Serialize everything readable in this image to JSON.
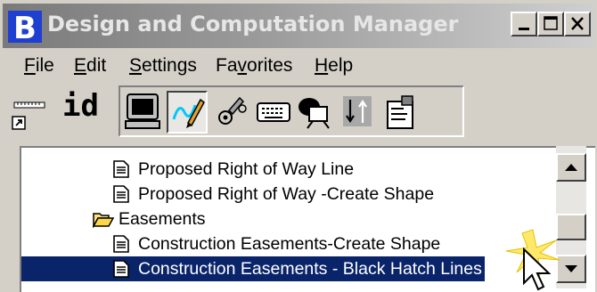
{
  "window": {
    "title": "Design and Computation Manager",
    "controls": [
      "minimize-icon",
      "maximize-icon",
      "close-icon"
    ]
  },
  "menu": {
    "items": [
      {
        "label": "File",
        "mnemonic": "F"
      },
      {
        "label": "Edit",
        "mnemonic": "E"
      },
      {
        "label": "Settings",
        "mnemonic": "S"
      },
      {
        "label": "Favorites",
        "mnemonic": "v"
      },
      {
        "label": "Help",
        "mnemonic": "H"
      }
    ]
  },
  "toolbar": {
    "id_label": "id",
    "buttons": [
      "monitor-icon",
      "draw-icon",
      "pencil-circles-icon",
      "keyboard-icon",
      "shapes-icon",
      "sort-icon",
      "properties-icon"
    ],
    "pressed": "draw-icon"
  },
  "tree": {
    "items": [
      {
        "label": "Proposed Right of Way Line",
        "icon": "document-icon",
        "level": 2
      },
      {
        "label": "Proposed Right of Way -Create Shape",
        "icon": "document-icon",
        "level": 2
      },
      {
        "label": "Easements",
        "icon": "folder-open-icon",
        "level": 1
      },
      {
        "label": "Construction Easements-Create Shape",
        "icon": "document-icon",
        "level": 2
      },
      {
        "label": "Construction Easements - Black Hatch Lines",
        "icon": "document-icon",
        "level": 2,
        "selected": true
      }
    ]
  },
  "colors": {
    "selection": "#0a246a",
    "titlebar_text": "#e6e6e6",
    "window_bg": "#d4d0c8"
  }
}
